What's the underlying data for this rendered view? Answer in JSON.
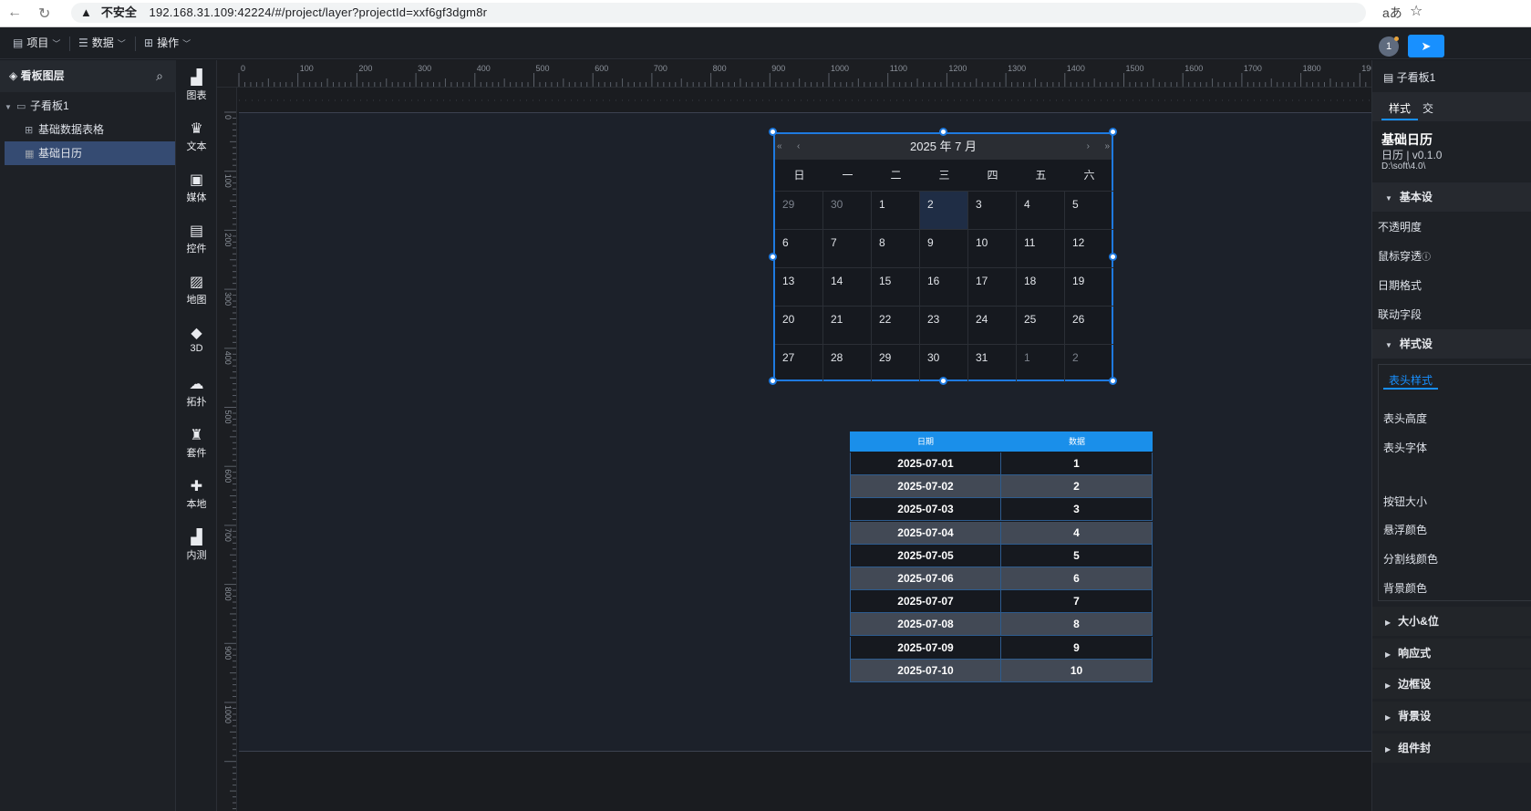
{
  "browser": {
    "warning": "不安全",
    "url": "192.168.31.109:42224/#/project/layer?projectId=xxf6gf3dgm8r",
    "reader_icon": "aあ",
    "star_icon": "☆"
  },
  "topbar": {
    "menus": [
      {
        "label": "项目",
        "icon": "document-icon"
      },
      {
        "label": "数据",
        "icon": "database-icon"
      },
      {
        "label": "操作",
        "icon": "grid-icon"
      }
    ],
    "avatar": "1"
  },
  "layers": {
    "title": "看板图层",
    "root": "子看板1",
    "items": [
      "基础数据表格",
      "基础日历"
    ],
    "selected": "基础日历"
  },
  "components": [
    "图表",
    "文本",
    "媒体",
    "控件",
    "地图",
    "3D",
    "拓扑",
    "套件",
    "本地",
    "内测"
  ],
  "ruler": {
    "top_labels": [
      "0",
      "100",
      "200",
      "300",
      "400",
      "500",
      "600",
      "700",
      "800",
      "900",
      "1000",
      "1100",
      "1200",
      "1300",
      "1400",
      "1500",
      "1600",
      "1700",
      "1800",
      "1900"
    ],
    "left_labels": [
      "0",
      "100",
      "200",
      "300",
      "400",
      "500",
      "600",
      "700",
      "800",
      "900",
      "1000"
    ]
  },
  "calendar": {
    "title": "2025 年 7 月",
    "nav": [
      "«",
      "‹",
      "›",
      "»"
    ],
    "weekdays": [
      "日",
      "一",
      "二",
      "三",
      "四",
      "五",
      "六"
    ],
    "weeks": [
      [
        "29",
        "30",
        "1",
        "2",
        "3",
        "4",
        "5"
      ],
      [
        "6",
        "7",
        "8",
        "9",
        "10",
        "11",
        "12"
      ],
      [
        "13",
        "14",
        "15",
        "16",
        "17",
        "18",
        "19"
      ],
      [
        "20",
        "21",
        "22",
        "23",
        "24",
        "25",
        "26"
      ],
      [
        "27",
        "28",
        "29",
        "30",
        "31",
        "1",
        "2"
      ]
    ],
    "highlighted": "2"
  },
  "table": {
    "headers": [
      "日期",
      "数据"
    ],
    "rows": [
      [
        "2025-07-01",
        "1"
      ],
      [
        "2025-07-02",
        "2"
      ],
      [
        "2025-07-03",
        "3"
      ],
      [
        "2025-07-04",
        "4"
      ],
      [
        "2025-07-05",
        "5"
      ],
      [
        "2025-07-06",
        "6"
      ],
      [
        "2025-07-07",
        "7"
      ],
      [
        "2025-07-08",
        "8"
      ],
      [
        "2025-07-09",
        "9"
      ],
      [
        "2025-07-10",
        "10"
      ]
    ]
  },
  "right_panel": {
    "breadcrumb": "子看板1",
    "tabs": [
      "样式",
      "交"
    ],
    "component_title": "基础日历",
    "component_version": "日历 | v0.1.0",
    "component_path": "D:\\soft\\4.0\\",
    "sections": {
      "basic": "基本设",
      "style": "样式设",
      "size": "大小&位",
      "responsive": "响应式",
      "border": "边框设",
      "background": "背景设",
      "component": "组件封"
    },
    "basic_fields": [
      "不透明度",
      "鼠标穿透",
      "日期格式",
      "联动字段"
    ],
    "style_tab": "表头样式",
    "style_fields": [
      "表头高度",
      "表头字体",
      "按钮大小",
      "悬浮颜色",
      "分割线颜色",
      "背景颜色"
    ]
  },
  "colors": {
    "accent": "#1890ff",
    "selection": "#1e7ae0",
    "table_header": "#1a8fea",
    "layer_selected": "#354b72"
  }
}
